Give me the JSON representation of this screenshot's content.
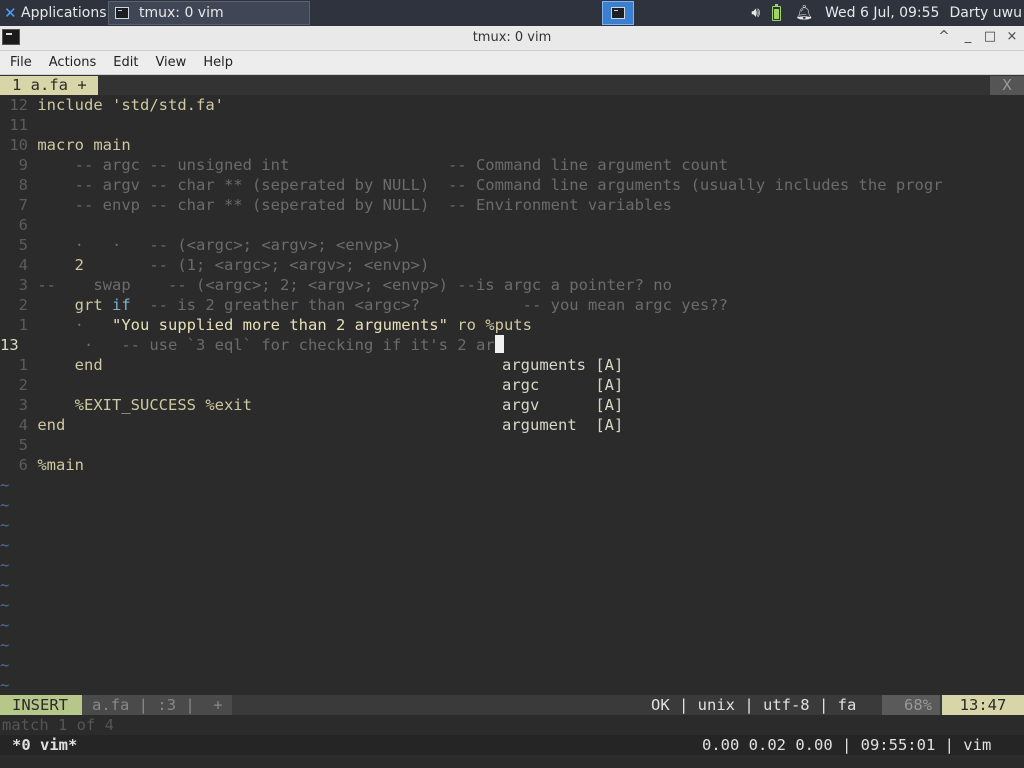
{
  "panel": {
    "applications": "Applications",
    "task_title": "tmux: 0 vim",
    "clock": "Wed  6 Jul, 09:55",
    "user": "Darty uwu",
    "icons": {
      "apps": "xfce-mouse-icon",
      "volume": "speaker-icon",
      "battery": "battery-icon",
      "bell": "bell-icon"
    }
  },
  "window": {
    "title": "tmux: 0 vim",
    "controls": {
      "shade": "^",
      "minimize": "_",
      "maximize": "□",
      "close": "×"
    }
  },
  "menu": [
    "File",
    "Actions",
    "Edit",
    "View",
    "Help"
  ],
  "vim": {
    "tab_label": "1 a.fa +",
    "tab_close": "X",
    "lines": [
      {
        "n": "12",
        "t": "include 'std/std.fa'"
      },
      {
        "n": "11",
        "t": ""
      },
      {
        "n": "10",
        "t": "macro main"
      },
      {
        "n": "9",
        "t": "    -- argc -- unsigned int                 -- Command line argument count"
      },
      {
        "n": "8",
        "t": "    -- argv -- char ** (seperated by NULL)  -- Command line arguments (usually includes the progr"
      },
      {
        "n": "7",
        "t": "    -- envp -- char ** (seperated by NULL)  -- Environment variables"
      },
      {
        "n": "6",
        "t": ""
      },
      {
        "n": "5",
        "t": "    ·   ·   -- (<argc>; <argv>; <envp>)"
      },
      {
        "n": "4",
        "t": "    2       -- (1; <argc>; <argv>; <envp>)"
      },
      {
        "n": "3",
        "t": "--    swap    -- (<argc>; 2; <argv>; <envp>) --is argc a pointer? no"
      },
      {
        "n": "2",
        "t": "    grt if  -- is 2 greather than <argc>?           -- you mean argc yes??"
      },
      {
        "n": "1",
        "t": "    ·   \"You supplied more than 2 arguments\" ro %puts"
      },
      {
        "n": "13",
        "t": "    ·   -- use `3 eql` for checking if it's 2 ar"
      },
      {
        "n": "1",
        "t": "    end"
      },
      {
        "n": "2",
        "t": ""
      },
      {
        "n": "3",
        "t": "    %EXIT_SUCCESS %exit"
      },
      {
        "n": "4",
        "t": "end"
      },
      {
        "n": "5",
        "t": ""
      },
      {
        "n": "6",
        "t": "%main"
      }
    ],
    "completions": [
      {
        "word": "arguments",
        "kind": "[A]"
      },
      {
        "word": "argc",
        "kind": "[A]"
      },
      {
        "word": "argv",
        "kind": "[A]"
      },
      {
        "word": "argument",
        "kind": "[A]"
      }
    ],
    "tilde": "~",
    "status": {
      "mode": "INSERT",
      "file": "a.fa",
      "sep": "|",
      "lineinfo": ":3",
      "plus": "+",
      "right": "OK | unix | utf-8 | fa",
      "percent": "68%",
      "position": "13:47"
    },
    "message": "match 1 of 4"
  },
  "tmux": {
    "window": "*0 vim*",
    "right": "0.00 0.02 0.00 | 09:55:01 | vim"
  }
}
